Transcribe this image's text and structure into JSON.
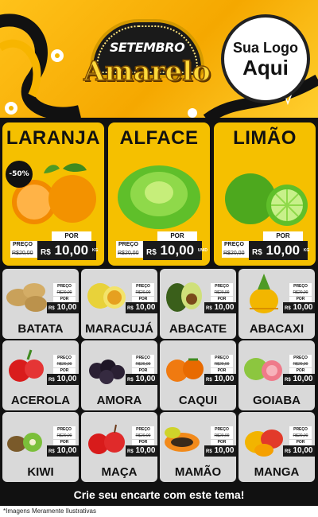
{
  "header": {
    "title_top": "SETEMBRO",
    "title_main": "Amarelo",
    "logo_line1": "Sua Logo",
    "logo_line2": "Aqui",
    "accent": "#f5b800"
  },
  "featured": [
    {
      "name": "LARANJA",
      "badge": "-50%",
      "preco_label": "PREÇO",
      "old_price": "R$20,00",
      "por_label": "POR",
      "currency": "R$",
      "price": "10,00",
      "unit": "KG",
      "icon": "orange-icon"
    },
    {
      "name": "ALFACE",
      "preco_label": "PREÇO",
      "old_price": "R$20,00",
      "por_label": "POR",
      "currency": "R$",
      "price": "10,00",
      "unit": "UNID",
      "icon": "lettuce-icon"
    },
    {
      "name": "LIMÃO",
      "preco_label": "PREÇO",
      "old_price": "R$20,00",
      "por_label": "POR",
      "currency": "R$",
      "price": "10,00",
      "unit": "KG",
      "icon": "lime-icon"
    }
  ],
  "products": [
    {
      "name": "BATATA",
      "preco_label": "PREÇO",
      "old_price": "R$20,00",
      "por_label": "POR",
      "currency": "R$",
      "price": "10,00",
      "unit": "KG",
      "icon": "potato-icon"
    },
    {
      "name": "MARACUJÁ",
      "preco_label": "PREÇO",
      "old_price": "R$20,00",
      "por_label": "POR",
      "currency": "R$",
      "price": "10,00",
      "unit": "KG",
      "icon": "passion-fruit-icon"
    },
    {
      "name": "ABACATE",
      "preco_label": "PREÇO",
      "old_price": "R$20,00",
      "por_label": "POR",
      "currency": "R$",
      "price": "10,00",
      "unit": "KG",
      "icon": "avocado-icon"
    },
    {
      "name": "ABACAXI",
      "preco_label": "PREÇO",
      "old_price": "R$20,00",
      "por_label": "POR",
      "currency": "R$",
      "price": "10,00",
      "unit": "KG",
      "icon": "pineapple-icon"
    },
    {
      "name": "ACEROLA",
      "preco_label": "PREÇO",
      "old_price": "R$20,00",
      "por_label": "POR",
      "currency": "R$",
      "price": "10,00",
      "unit": "KG",
      "icon": "acerola-icon"
    },
    {
      "name": "AMORA",
      "preco_label": "PREÇO",
      "old_price": "R$20,00",
      "por_label": "POR",
      "currency": "R$",
      "price": "10,00",
      "unit": "KG",
      "icon": "blackberry-icon"
    },
    {
      "name": "CAQUI",
      "preco_label": "PREÇO",
      "old_price": "R$20,00",
      "por_label": "POR",
      "currency": "R$",
      "price": "10,00",
      "unit": "KG",
      "icon": "persimmon-icon"
    },
    {
      "name": "GOIABA",
      "preco_label": "PREÇO",
      "old_price": "R$20,00",
      "por_label": "POR",
      "currency": "R$",
      "price": "10,00",
      "unit": "KG",
      "icon": "guava-icon"
    },
    {
      "name": "KIWI",
      "preco_label": "PREÇO",
      "old_price": "R$20,00",
      "por_label": "POR",
      "currency": "R$",
      "price": "10,00",
      "unit": "KG",
      "icon": "kiwi-icon"
    },
    {
      "name": "MAÇA",
      "preco_label": "PREÇO",
      "old_price": "R$20,00",
      "por_label": "POR",
      "currency": "R$",
      "price": "10,00",
      "unit": "KG",
      "icon": "apple-icon"
    },
    {
      "name": "MAMÃO",
      "preco_label": "PREÇO",
      "old_price": "R$20,00",
      "por_label": "POR",
      "currency": "R$",
      "price": "10,00",
      "unit": "KG",
      "icon": "papaya-icon"
    },
    {
      "name": "MANGA",
      "preco_label": "PREÇO",
      "old_price": "R$20,00",
      "por_label": "POR",
      "currency": "R$",
      "price": "10,00",
      "unit": "KG",
      "icon": "mango-icon"
    }
  ],
  "footer": {
    "cta": "Crie seu encarte com este tema!",
    "note": "*Imagens Meramente Ilustrativas"
  }
}
